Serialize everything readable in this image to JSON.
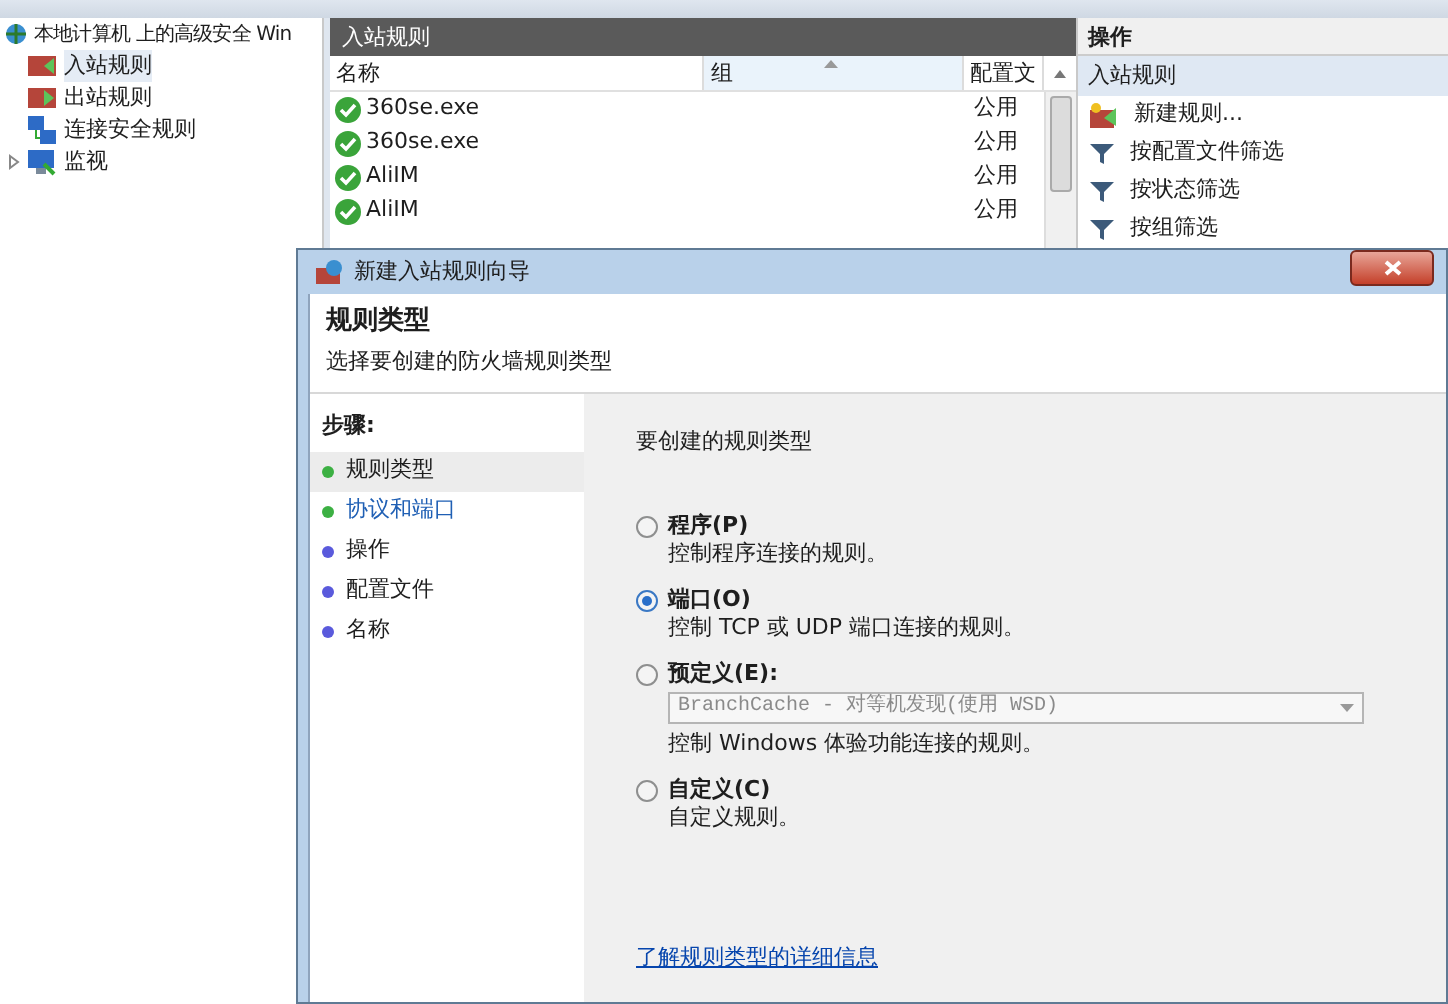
{
  "tree": {
    "root": "本地计算机 上的高级安全 Win",
    "items": [
      {
        "label": "入站规则",
        "kind": "inbound",
        "selected": true,
        "expandable": false
      },
      {
        "label": "出站规则",
        "kind": "outbound",
        "selected": false,
        "expandable": false
      },
      {
        "label": "连接安全规则",
        "kind": "security",
        "selected": false,
        "expandable": false
      },
      {
        "label": "监视",
        "kind": "monitor",
        "selected": false,
        "expandable": true
      }
    ]
  },
  "rules_panel": {
    "title": "入站规则",
    "columns": [
      {
        "label": "名称",
        "sorted": false
      },
      {
        "label": "组",
        "sorted": true
      },
      {
        "label": "配置文",
        "sorted": false
      }
    ],
    "rows": [
      {
        "name": "360se.exe",
        "profile": "公用",
        "enabled": true
      },
      {
        "name": "360se.exe",
        "profile": "公用",
        "enabled": true
      },
      {
        "name": "AliIM",
        "profile": "公用",
        "enabled": true
      },
      {
        "name": "AliIM",
        "profile": "公用",
        "enabled": true
      }
    ]
  },
  "actions_panel": {
    "title": "操作",
    "section": "入站规则",
    "items": [
      {
        "label": "新建规则...",
        "kind": "new"
      },
      {
        "label": "按配置文件筛选",
        "kind": "filter"
      },
      {
        "label": "按状态筛选",
        "kind": "filter"
      },
      {
        "label": "按组筛选",
        "kind": "filter"
      }
    ]
  },
  "dialog": {
    "title": "新建入站规则向导",
    "heading": "规则类型",
    "subheading": "选择要创建的防火墙规则类型",
    "steps_title": "步骤:",
    "steps": [
      {
        "label": "规则类型",
        "color": "#3cb043",
        "selected": true,
        "hovered": false
      },
      {
        "label": "协议和端口",
        "color": "#3cb043",
        "selected": false,
        "hovered": true
      },
      {
        "label": "操作",
        "color": "#5a5adc",
        "selected": false,
        "hovered": false
      },
      {
        "label": "配置文件",
        "color": "#5a5adc",
        "selected": false,
        "hovered": false
      },
      {
        "label": "名称",
        "color": "#5a5adc",
        "selected": false,
        "hovered": false
      }
    ],
    "prompt": "要创建的规则类型",
    "options": [
      {
        "label": "程序(P)",
        "description": "控制程序连接的规则。",
        "selected": false
      },
      {
        "label": "端口(O)",
        "description": "控制 TCP 或 UDP 端口连接的规则。",
        "selected": true
      },
      {
        "label": "预定义(E):",
        "description": "控制 Windows 体验功能连接的规则。",
        "selected": false,
        "dropdown": {
          "value": "BranchCache - 对等机发现(使用 WSD)",
          "disabled": true
        }
      },
      {
        "label": "自定义(C)",
        "description": "自定义规则。",
        "selected": false
      }
    ],
    "link": "了解规则类型的详细信息"
  }
}
